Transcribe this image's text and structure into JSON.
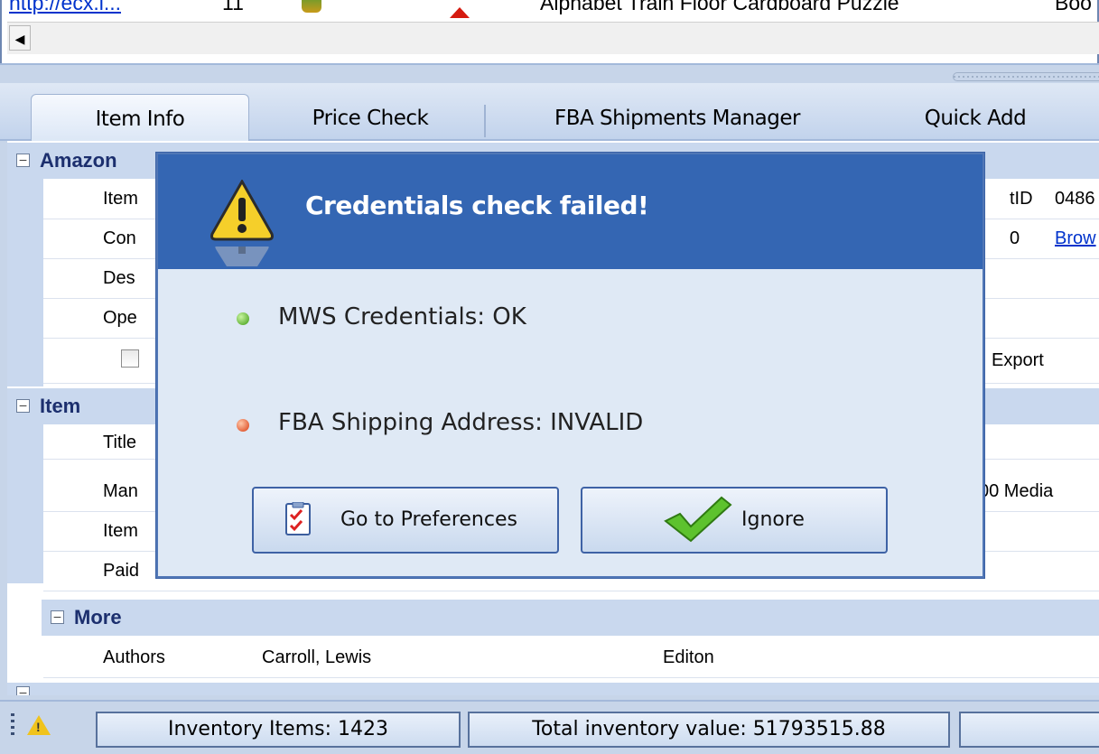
{
  "top_row": {
    "link": "http://ecx.i...",
    "count": "11",
    "title": "Alphabet Train Floor Cardboard Puzzle",
    "last": "Boo"
  },
  "tabs": [
    "Item Info",
    "Price Check",
    "FBA Shipments Manager",
    "Quick Add"
  ],
  "grid": {
    "amazon": {
      "header": "Amazon",
      "rows": [
        {
          "label": "Item",
          "right_label": "tID",
          "right_value": "0486"
        },
        {
          "label": "Con",
          "right_label": "0",
          "right_link": "Brow"
        },
        {
          "label": "Des"
        },
        {
          "label": "Ope"
        },
        {
          "export": "Export"
        }
      ]
    },
    "item": {
      "header": "Item",
      "rows": [
        {
          "label": "Title"
        },
        {
          "label": "Man",
          "right_value": "00 Media"
        },
        {
          "label": "Item"
        },
        {
          "label": "Paid"
        }
      ]
    },
    "more": {
      "header": "More",
      "authors_label": "Authors",
      "authors_value": "Carroll, Lewis",
      "edition_label": "Editon"
    }
  },
  "status": {
    "inventory_items": "Inventory Items: 1423",
    "total_value": "Total inventory value: 51793515.88"
  },
  "dialog": {
    "title": "Credentials check failed!",
    "mws": "MWS Credentials: OK",
    "fba": "FBA Shipping Address: INVALID",
    "btn_prefs": "Go to Preferences",
    "btn_ignore": "Ignore",
    "colors": {
      "ok": "#3c9a12",
      "invalid": "#d93a10",
      "header": "#3466b3"
    }
  }
}
